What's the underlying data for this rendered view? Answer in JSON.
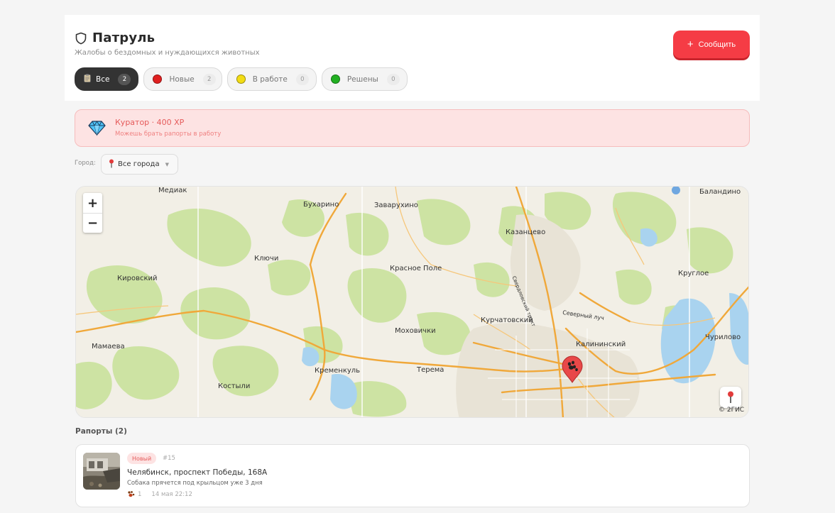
{
  "header": {
    "title": "Патруль",
    "subtitle": "Жалобы о бездомных и нуждающихся животных",
    "report_button": "Сообщить",
    "report_button_icon": "+"
  },
  "filters": [
    {
      "label": "Все",
      "count": "2",
      "icon": "clipboard-icon",
      "active": true
    },
    {
      "label": "Новые",
      "count": "2",
      "color": "#e02020"
    },
    {
      "label": "В работе",
      "count": "0",
      "color": "#f2dc14"
    },
    {
      "label": "Решены",
      "count": "0",
      "color": "#22b022"
    }
  ],
  "curator": {
    "title": "Куратор · 400 XP",
    "subtitle": "Можешь брать рапорты в работу",
    "icon": "diamond-icon"
  },
  "city": {
    "label": "Город:",
    "value": "Все города"
  },
  "map": {
    "zoom_in": "+",
    "zoom_out": "−",
    "copyright": "© 2ГИС",
    "labels": {
      "mediak": "Медиак",
      "bukharino": "Бухарино",
      "zavarukhino": "Заварухино",
      "balandino": "Баландино",
      "kazantsevo": "Казанцево",
      "klyuchi": "Ключи",
      "krasnoe_pole": "Красное Поле",
      "kirovsky": "Кировский",
      "krugloe": "Круглое",
      "kurchatovsky": "Курчатовский",
      "severny_luch": "Северный луч",
      "mokhovichki": "Моховички",
      "mamaeva": "Мамаева",
      "kalininsky": "Калининский",
      "churilovo": "Чурилово",
      "kremenkul": "Кременкуль",
      "terema": "Терема",
      "kostyli": "Костыли",
      "sverdlovsky_trakt": "Свердловский тракт"
    }
  },
  "reports": {
    "title": "Рапорты (2)",
    "items": [
      {
        "status": "Новый",
        "number": "#15",
        "address": "Челябинск, проспект Победы, 168А",
        "description": "Собака прячется под крыльцом уже 3 дня",
        "animals": "1",
        "time": "14 мая 22:12"
      }
    ]
  }
}
